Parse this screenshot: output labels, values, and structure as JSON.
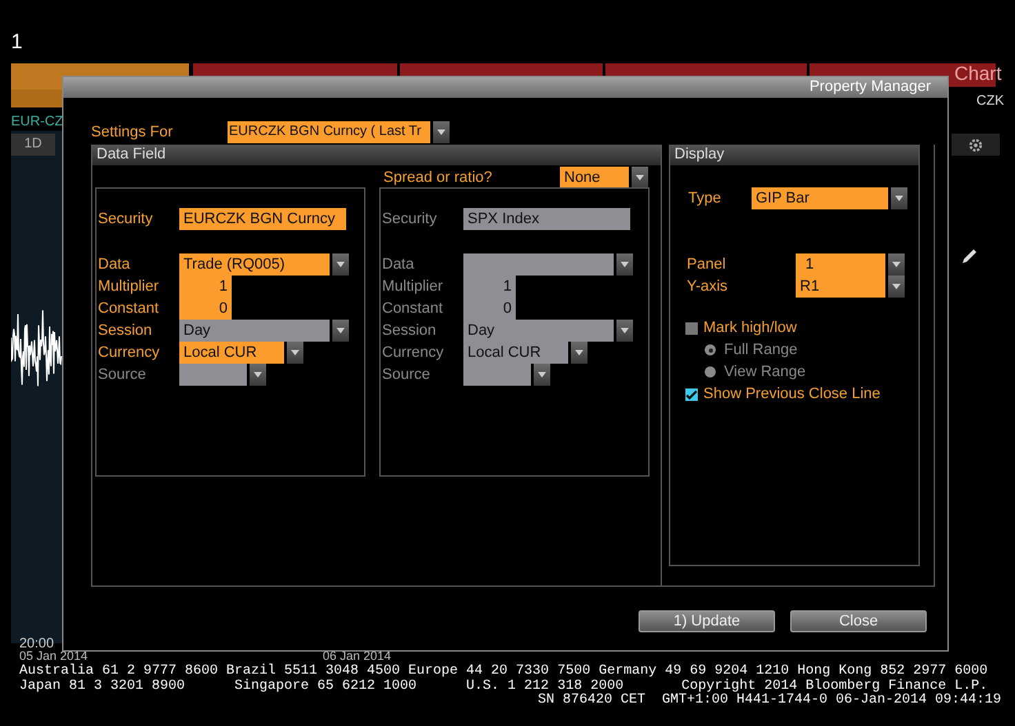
{
  "app": {
    "window_number": "1",
    "currency": "CZK",
    "security_short": "EUR-CZ",
    "period_tab": "1D",
    "chart_title_fragment": "Chart",
    "time_label": "20:00",
    "date_labels": [
      "05 Jan 2014",
      "06 Jan 2014"
    ]
  },
  "dialog": {
    "title": "Property Manager",
    "settings_for": {
      "label": "Settings For",
      "value": "EURCZK BGN Curncy ( Last Tr"
    },
    "data_field": {
      "title": "Data Field",
      "spread": {
        "label": "Spread or ratio?",
        "value": "None"
      },
      "columns": [
        {
          "rows": [
            {
              "label": "Security",
              "value": "EURCZK BGN Curncy",
              "kind": "text",
              "highlighted": true,
              "disabled": false
            },
            {
              "label": "Data",
              "value": "Trade (RQ005)",
              "kind": "dropdown",
              "highlighted": true,
              "disabled": false
            },
            {
              "label": "Multiplier",
              "value": "1",
              "kind": "number",
              "highlighted": true,
              "disabled": false
            },
            {
              "label": "Constant",
              "value": "0",
              "kind": "number",
              "highlighted": true,
              "disabled": false
            },
            {
              "label": "Session",
              "value": "Day",
              "kind": "dropdown",
              "highlighted": false,
              "disabled": false
            },
            {
              "label": "Currency",
              "value": "Local CUR",
              "kind": "dropdown",
              "highlighted": true,
              "disabled": false
            },
            {
              "label": "Source",
              "kind": "dropdown",
              "highlighted": false,
              "disabled": true
            }
          ]
        },
        {
          "rows": [
            {
              "label": "Security",
              "value": "SPX Index",
              "kind": "text",
              "highlighted": false,
              "disabled": true
            },
            {
              "label": "Data",
              "kind": "dropdown",
              "highlighted": false,
              "disabled": true
            },
            {
              "label": "Multiplier",
              "value": "1",
              "kind": "number",
              "highlighted": false,
              "disabled": true
            },
            {
              "label": "Constant",
              "value": "0",
              "kind": "number",
              "highlighted": false,
              "disabled": true
            },
            {
              "label": "Session",
              "value": "Day",
              "kind": "dropdown",
              "highlighted": false,
              "disabled": true
            },
            {
              "label": "Currency",
              "value": "Local CUR",
              "kind": "dropdown",
              "highlighted": false,
              "disabled": true
            },
            {
              "label": "Source",
              "kind": "dropdown",
              "highlighted": false,
              "disabled": true
            }
          ]
        }
      ]
    },
    "display": {
      "title": "Display",
      "type": {
        "label": "Type",
        "value": "GIP Bar"
      },
      "panel": {
        "label": "Panel",
        "value": "1"
      },
      "y_axis": {
        "label": "Y-axis",
        "value": "R1"
      },
      "mark_high_low": {
        "label": "Mark high/low",
        "checked": false
      },
      "range_options": [
        {
          "label": "Full Range",
          "selected": true,
          "disabled": true
        },
        {
          "label": "View Range",
          "selected": false,
          "disabled": true
        }
      ],
      "show_previous_close": {
        "label": "Show Previous Close Line",
        "checked": true
      }
    },
    "buttons": [
      {
        "label": "1) Update"
      },
      {
        "label": "Close"
      }
    ]
  },
  "footer": {
    "lines": [
      "Australia 61 2 9777 8600 Brazil 5511 3048 4500 Europe 44 20 7330 7500 Germany 49 69 9204 1210 Hong Kong 852 2977 6000",
      "Japan 81 3 3201 8900      Singapore 65 6212 1000      U.S. 1 212 318 2000       Copyright 2014 Bloomberg Finance L.P.",
      "SN 876420 CET  GMT+1:00 H441-1744-0 06-Jan-2014 09:44:19"
    ]
  }
}
